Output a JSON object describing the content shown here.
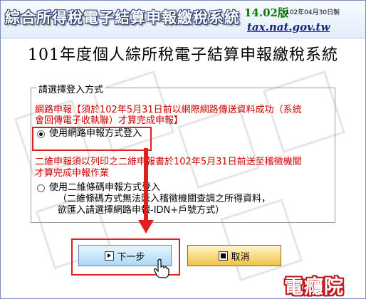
{
  "header": {
    "app_title": "綜合所得稅電子結算申報繳稅系統",
    "version": "14.02版",
    "version_date": "102年04月30日製",
    "site": "tax.nat.gov.tw"
  },
  "main_title": "101年度個人綜所稅電子結算申報繳稅系統",
  "login": {
    "legend": "請選擇登入方式",
    "online_desc_line1": "網路申報【須於102年5月31日前以網際網路傳送資料成功（系統",
    "online_desc_line2": "會回傳電子收執聯）才算完成申報】",
    "online_option": "使用網路申報方式登入",
    "barcode_desc_line1": "二維申報須以列印之二維申報書於102年5月31日前送至稽徵機關",
    "barcode_desc_line2": "才算完成申報作業",
    "barcode_option": "使用二維條碼申報方式登入",
    "barcode_note_line1": "（二維條碼方式無法匯入稽徵機關查調之所得資料，",
    "barcode_note_line2": "欲匯入請選擇網路申報-IDN+戶號方式）"
  },
  "buttons": {
    "next": "下一步",
    "cancel": "取消"
  },
  "watermark": "電癮院",
  "colors": {
    "highlight": "#e02020",
    "warning_text": "#cc0000",
    "link": "#1a237e",
    "version": "#0b7a0b"
  }
}
